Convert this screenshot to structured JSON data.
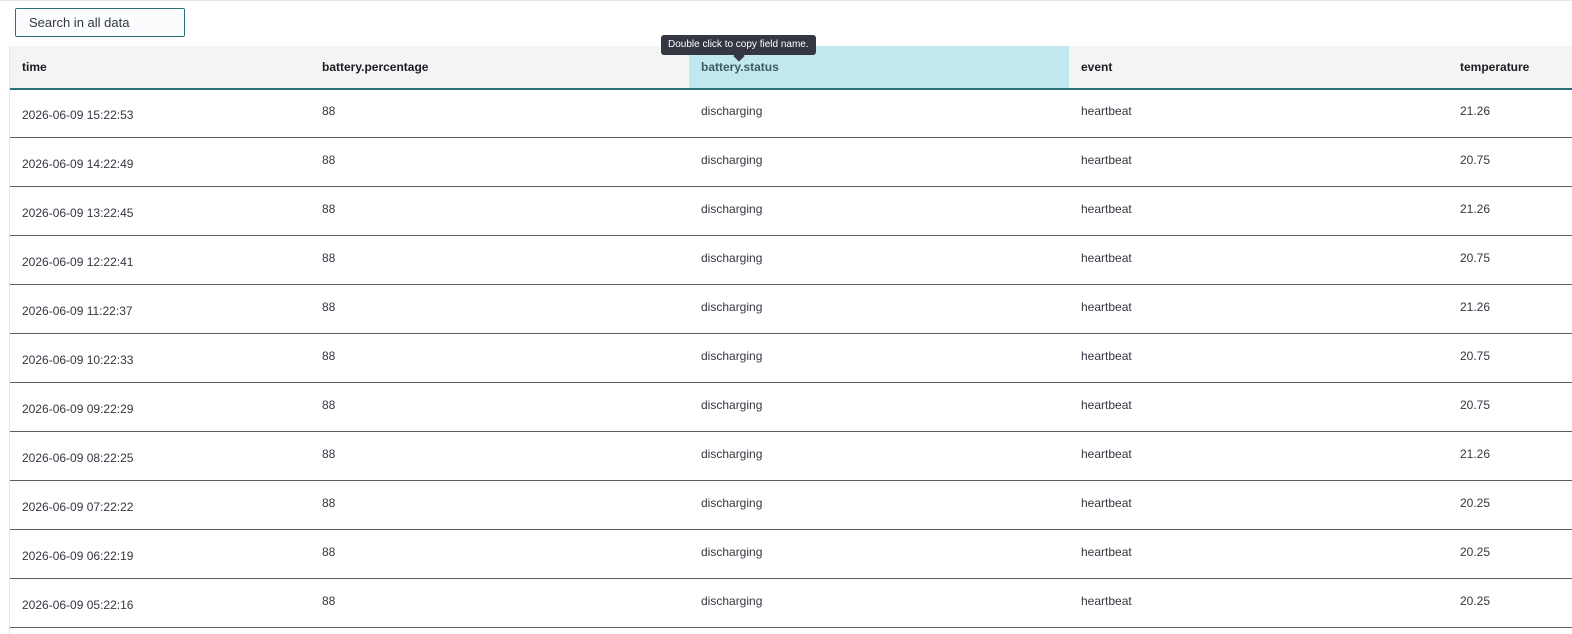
{
  "search": {
    "placeholder": "Search in all data"
  },
  "tooltip": {
    "text": "Double click to copy field name."
  },
  "table": {
    "columns": [
      {
        "key": "time",
        "label": "time"
      },
      {
        "key": "battery_percentage",
        "label": "battery.percentage"
      },
      {
        "key": "battery_status",
        "label": "battery.status",
        "highlighted": true
      },
      {
        "key": "event",
        "label": "event"
      },
      {
        "key": "temperature",
        "label": "temperature"
      }
    ],
    "rows": [
      {
        "time": "2026-06-09 15:22:53",
        "battery_percentage": "88",
        "battery_status": "discharging",
        "event": "heartbeat",
        "temperature": "21.26"
      },
      {
        "time": "2026-06-09 14:22:49",
        "battery_percentage": "88",
        "battery_status": "discharging",
        "event": "heartbeat",
        "temperature": "20.75"
      },
      {
        "time": "2026-06-09 13:22:45",
        "battery_percentage": "88",
        "battery_status": "discharging",
        "event": "heartbeat",
        "temperature": "21.26"
      },
      {
        "time": "2026-06-09 12:22:41",
        "battery_percentage": "88",
        "battery_status": "discharging",
        "event": "heartbeat",
        "temperature": "20.75"
      },
      {
        "time": "2026-06-09 11:22:37",
        "battery_percentage": "88",
        "battery_status": "discharging",
        "event": "heartbeat",
        "temperature": "21.26"
      },
      {
        "time": "2026-06-09 10:22:33",
        "battery_percentage": "88",
        "battery_status": "discharging",
        "event": "heartbeat",
        "temperature": "20.75"
      },
      {
        "time": "2026-06-09 09:22:29",
        "battery_percentage": "88",
        "battery_status": "discharging",
        "event": "heartbeat",
        "temperature": "20.75"
      },
      {
        "time": "2026-06-09 08:22:25",
        "battery_percentage": "88",
        "battery_status": "discharging",
        "event": "heartbeat",
        "temperature": "21.26"
      },
      {
        "time": "2026-06-09 07:22:22",
        "battery_percentage": "88",
        "battery_status": "discharging",
        "event": "heartbeat",
        "temperature": "20.25"
      },
      {
        "time": "2026-06-09 06:22:19",
        "battery_percentage": "88",
        "battery_status": "discharging",
        "event": "heartbeat",
        "temperature": "20.25"
      },
      {
        "time": "2026-06-09 05:22:16",
        "battery_percentage": "88",
        "battery_status": "discharging",
        "event": "heartbeat",
        "temperature": "20.25"
      }
    ]
  },
  "colors": {
    "accent": "#2a6f7a",
    "highlight_header": "#c2e8ef",
    "header_bg": "#f3f5f5",
    "tooltip_bg": "#343741"
  }
}
